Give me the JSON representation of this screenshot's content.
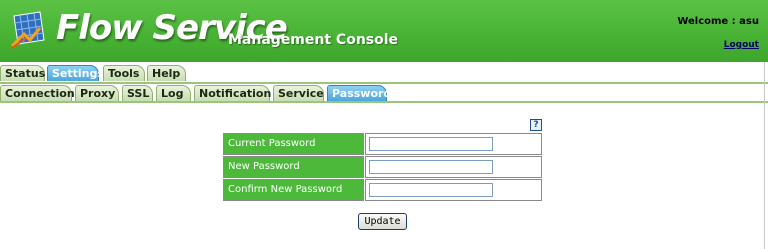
{
  "header": {
    "app_name": "Flow Service",
    "app_subtitle": "Management Console",
    "welcome_label": "Welcome :",
    "username": "asu",
    "logout_label": "Logout",
    "logo_icon": "flow-logo-icon",
    "colors": {
      "header_green": "#47b233",
      "label_green": "#4cb93a",
      "active_tab_blue": "#4aa6dc"
    }
  },
  "main_tabs": [
    {
      "label": "Status",
      "active": false
    },
    {
      "label": "Settings",
      "active": true
    },
    {
      "label": "Tools",
      "active": false
    },
    {
      "label": "Help",
      "active": false
    }
  ],
  "sub_tabs": [
    {
      "label": "Connection",
      "active": false
    },
    {
      "label": "Proxy",
      "active": false
    },
    {
      "label": "SSL",
      "active": false
    },
    {
      "label": "Log",
      "active": false
    },
    {
      "label": "Notification",
      "active": false
    },
    {
      "label": "Service",
      "active": false
    },
    {
      "label": "Password",
      "active": true
    }
  ],
  "help_icon": {
    "name": "help-question-icon",
    "glyph": "?"
  },
  "form": {
    "fields": [
      {
        "label": "Current Password",
        "value": ""
      },
      {
        "label": "New Password",
        "value": ""
      },
      {
        "label": "Confirm New Password",
        "value": ""
      }
    ],
    "submit_label": "Update"
  }
}
